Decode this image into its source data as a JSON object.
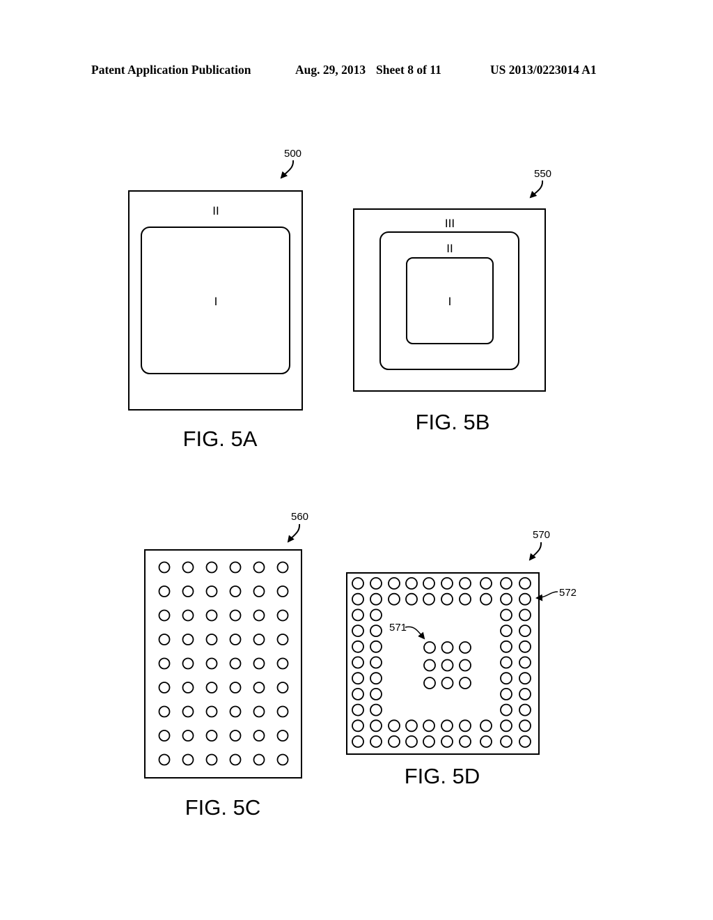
{
  "header": {
    "publication": "Patent Application Publication",
    "date": "Aug. 29, 2013",
    "sheet": "Sheet 8 of 11",
    "number": "US 2013/0223014 A1"
  },
  "figures": {
    "fig5a": {
      "caption": "FIG. 5A",
      "ref": "500",
      "regions": {
        "outer": "II",
        "inner": "I"
      }
    },
    "fig5b": {
      "caption": "FIG. 5B",
      "ref": "550",
      "regions": {
        "outer": "III",
        "middle": "II",
        "inner": "I"
      }
    },
    "fig5c": {
      "caption": "FIG. 5C",
      "ref": "560",
      "grid": {
        "columns": 6,
        "rows": 9
      }
    },
    "fig5d": {
      "caption": "FIG. 5D",
      "ref": "570",
      "ref_center": "571",
      "ref_perimeter": "572",
      "perimeter_grid": {
        "columns": 10,
        "rows": 11,
        "ring_depth": 2
      },
      "center_grid": {
        "columns": 3,
        "rows": 3
      }
    }
  }
}
